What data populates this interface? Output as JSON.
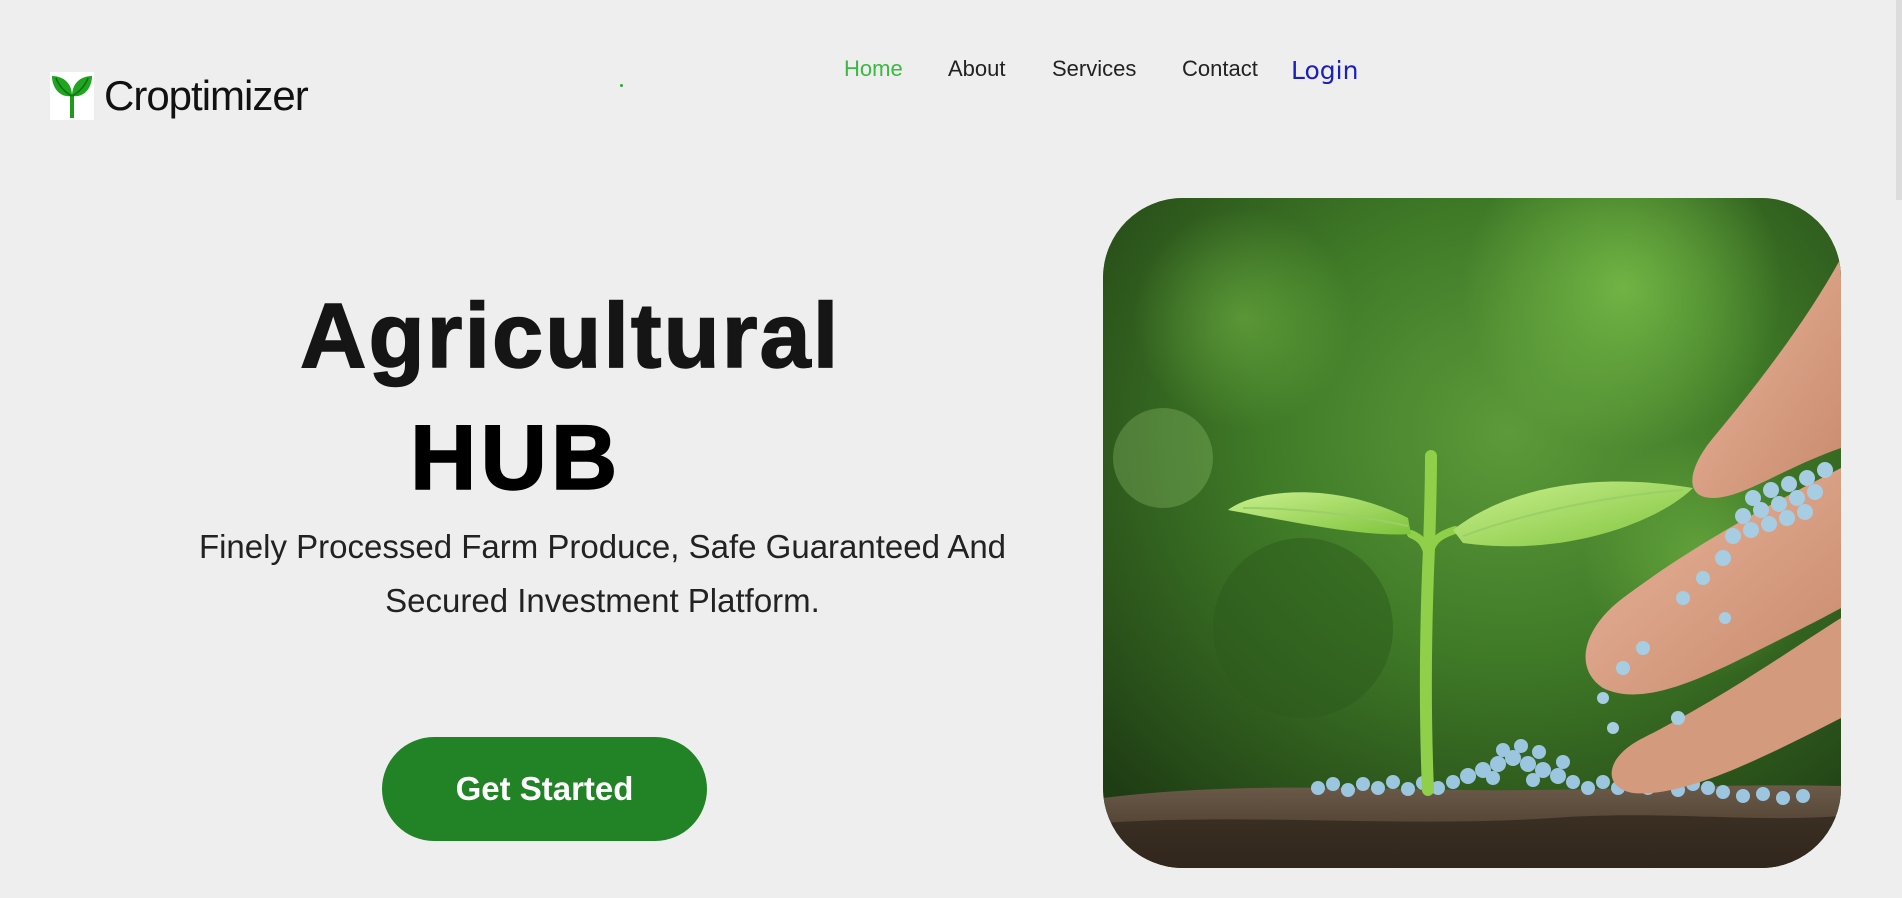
{
  "brand": {
    "name": "Croptimizer"
  },
  "nav": {
    "home": "Home",
    "about": "About",
    "services": "Services",
    "contact": "Contact",
    "login": "Login"
  },
  "hero": {
    "title_line1": "Agricultural",
    "title_line2": "HUB",
    "subtitle": "Finely Processed Farm Produce, Safe Guaranteed And Secured Investment Platform.",
    "cta": "Get Started",
    "image_icon": "seedling-with-fertilizer-photo"
  },
  "colors": {
    "background": "#eeeeee",
    "accent_green": "#3cb844",
    "cta_green": "#228226",
    "login_blue": "#1a1fbd"
  }
}
